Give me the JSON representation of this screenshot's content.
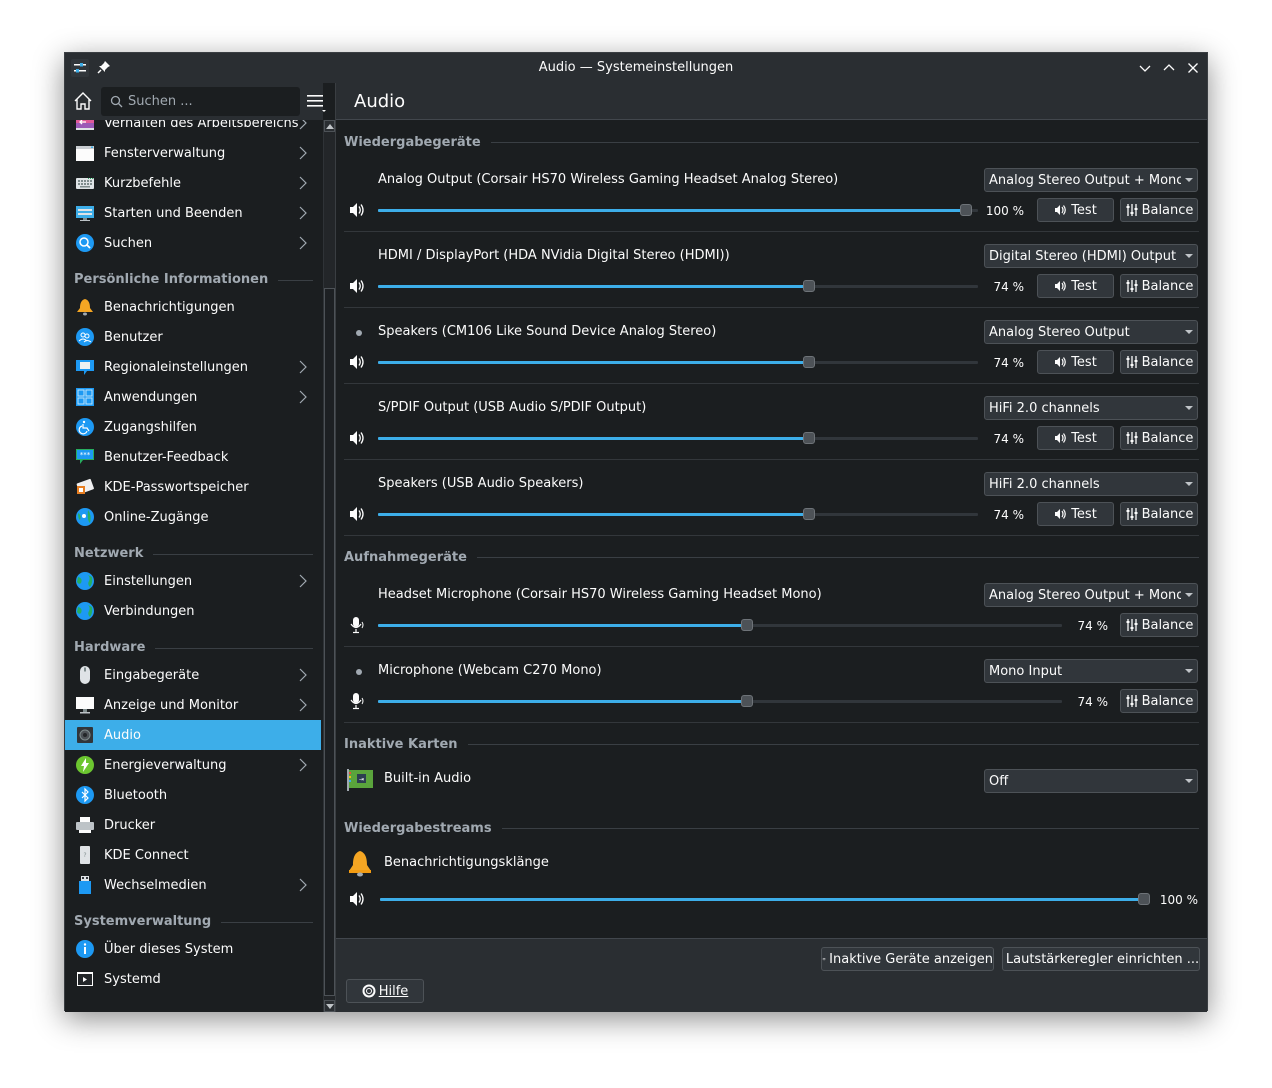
{
  "window": {
    "title": "Audio — Systemeinstellungen"
  },
  "search": {
    "placeholder": "Suchen ..."
  },
  "sidebar": {
    "items_top": [
      {
        "label": "Verhalten des Arbeitsbereichs",
        "icon": "workspace-behavior-icon",
        "chevron": true
      },
      {
        "label": "Fensterverwaltung",
        "icon": "window-management-icon",
        "chevron": true
      },
      {
        "label": "Kurzbefehle",
        "icon": "keyboard-icon",
        "chevron": true
      },
      {
        "label": "Starten und Beenden",
        "icon": "startup-shutdown-icon",
        "chevron": true
      },
      {
        "label": "Suchen",
        "icon": "search-magnifier-icon",
        "chevron": true
      }
    ],
    "sections": [
      {
        "title": "Persönliche Informationen",
        "items": [
          {
            "label": "Benachrichtigungen",
            "icon": "bell-icon",
            "chevron": false
          },
          {
            "label": "Benutzer",
            "icon": "users-icon",
            "chevron": false
          },
          {
            "label": "Regionaleinstellungen",
            "icon": "regional-settings-icon",
            "chevron": true
          },
          {
            "label": "Anwendungen",
            "icon": "applications-icon",
            "chevron": true
          },
          {
            "label": "Zugangshilfen",
            "icon": "accessibility-icon",
            "chevron": false
          },
          {
            "label": "Benutzer-Feedback",
            "icon": "feedback-icon",
            "chevron": false
          },
          {
            "label": "KDE-Passwortspeicher",
            "icon": "wallet-icon",
            "chevron": false
          },
          {
            "label": "Online-Zugänge",
            "icon": "online-accounts-icon",
            "chevron": false
          }
        ]
      },
      {
        "title": "Netzwerk",
        "items": [
          {
            "label": "Einstellungen",
            "icon": "globe-icon",
            "chevron": true
          },
          {
            "label": "Verbindungen",
            "icon": "globe-icon",
            "chevron": false
          }
        ]
      },
      {
        "title": "Hardware",
        "items": [
          {
            "label": "Eingabegeräte",
            "icon": "mouse-icon",
            "chevron": true
          },
          {
            "label": "Anzeige und Monitor",
            "icon": "monitor-icon",
            "chevron": true
          },
          {
            "label": "Audio",
            "icon": "speaker-icon",
            "chevron": false,
            "active": true
          },
          {
            "label": "Energieverwaltung",
            "icon": "power-icon",
            "chevron": true
          },
          {
            "label": "Bluetooth",
            "icon": "bluetooth-icon",
            "chevron": false
          },
          {
            "label": "Drucker",
            "icon": "printer-icon",
            "chevron": false
          },
          {
            "label": "KDE Connect",
            "icon": "phone-icon",
            "chevron": false
          },
          {
            "label": "Wechselmedien",
            "icon": "usb-drive-icon",
            "chevron": true
          }
        ]
      },
      {
        "title": "Systemverwaltung",
        "items": [
          {
            "label": "Über dieses System",
            "icon": "info-icon",
            "chevron": false
          },
          {
            "label": "Systemd",
            "icon": "terminal-icon",
            "chevron": false
          }
        ]
      }
    ]
  },
  "main": {
    "title": "Audio",
    "playback_title": "Wiedergabegeräte",
    "playback_devices": [
      {
        "name": "Analog Output (Corsair HS70 Wireless Gaming Headset Analog Stereo)",
        "profile": "Analog Stereo Output + Mono I",
        "volume_percent": 100,
        "volume_label": "100 %",
        "default": false
      },
      {
        "name": "HDMI / DisplayPort (HDA NVidia Digital Stereo (HDMI))",
        "profile": "Digital Stereo (HDMI) Output",
        "volume_percent": 74,
        "volume_label": "74 %",
        "default": false
      },
      {
        "name": "Speakers (CM106 Like Sound Device Analog Stereo)",
        "profile": "Analog Stereo Output",
        "volume_percent": 74,
        "volume_label": "74 %",
        "default": true
      },
      {
        "name": "S/PDIF Output (USB Audio S/PDIF Output)",
        "profile": "HiFi 2.0 channels",
        "volume_percent": 74,
        "volume_label": "74 %",
        "default": false
      },
      {
        "name": "Speakers (USB Audio Speakers)",
        "profile": "HiFi 2.0 channels",
        "volume_percent": 74,
        "volume_label": "74 %",
        "default": false
      }
    ],
    "test_label": "Test",
    "balance_label": "Balance",
    "capture_title": "Aufnahmegeräte",
    "capture_devices": [
      {
        "name": "Headset Microphone (Corsair HS70 Wireless Gaming Headset Mono)",
        "profile": "Analog Stereo Output + Mono I",
        "volume_percent": 74,
        "volume_label": "74 %",
        "default": false
      },
      {
        "name": "Microphone (Webcam C270 Mono)",
        "profile": "Mono Input",
        "volume_percent": 74,
        "volume_label": "74 %",
        "default": true
      }
    ],
    "inactive_cards_title": "Inaktive Karten",
    "inactive_cards": [
      {
        "name": "Built-in Audio",
        "profile": "Off"
      }
    ],
    "streams_title": "Wiedergabestreams",
    "streams": [
      {
        "name": "Benachrichtigungsklänge",
        "volume_percent": 100,
        "volume_label": "100 %"
      }
    ]
  },
  "footer": {
    "show_inactive_label": "Inaktive Geräte anzeigen",
    "configure_volume_label": "Lautstärkeregler einrichten ...",
    "help_label": "Hilfe"
  },
  "colors": {
    "accent": "#3daee9",
    "window_bg": "#1b1e20",
    "header_bg": "#2a2e32"
  }
}
